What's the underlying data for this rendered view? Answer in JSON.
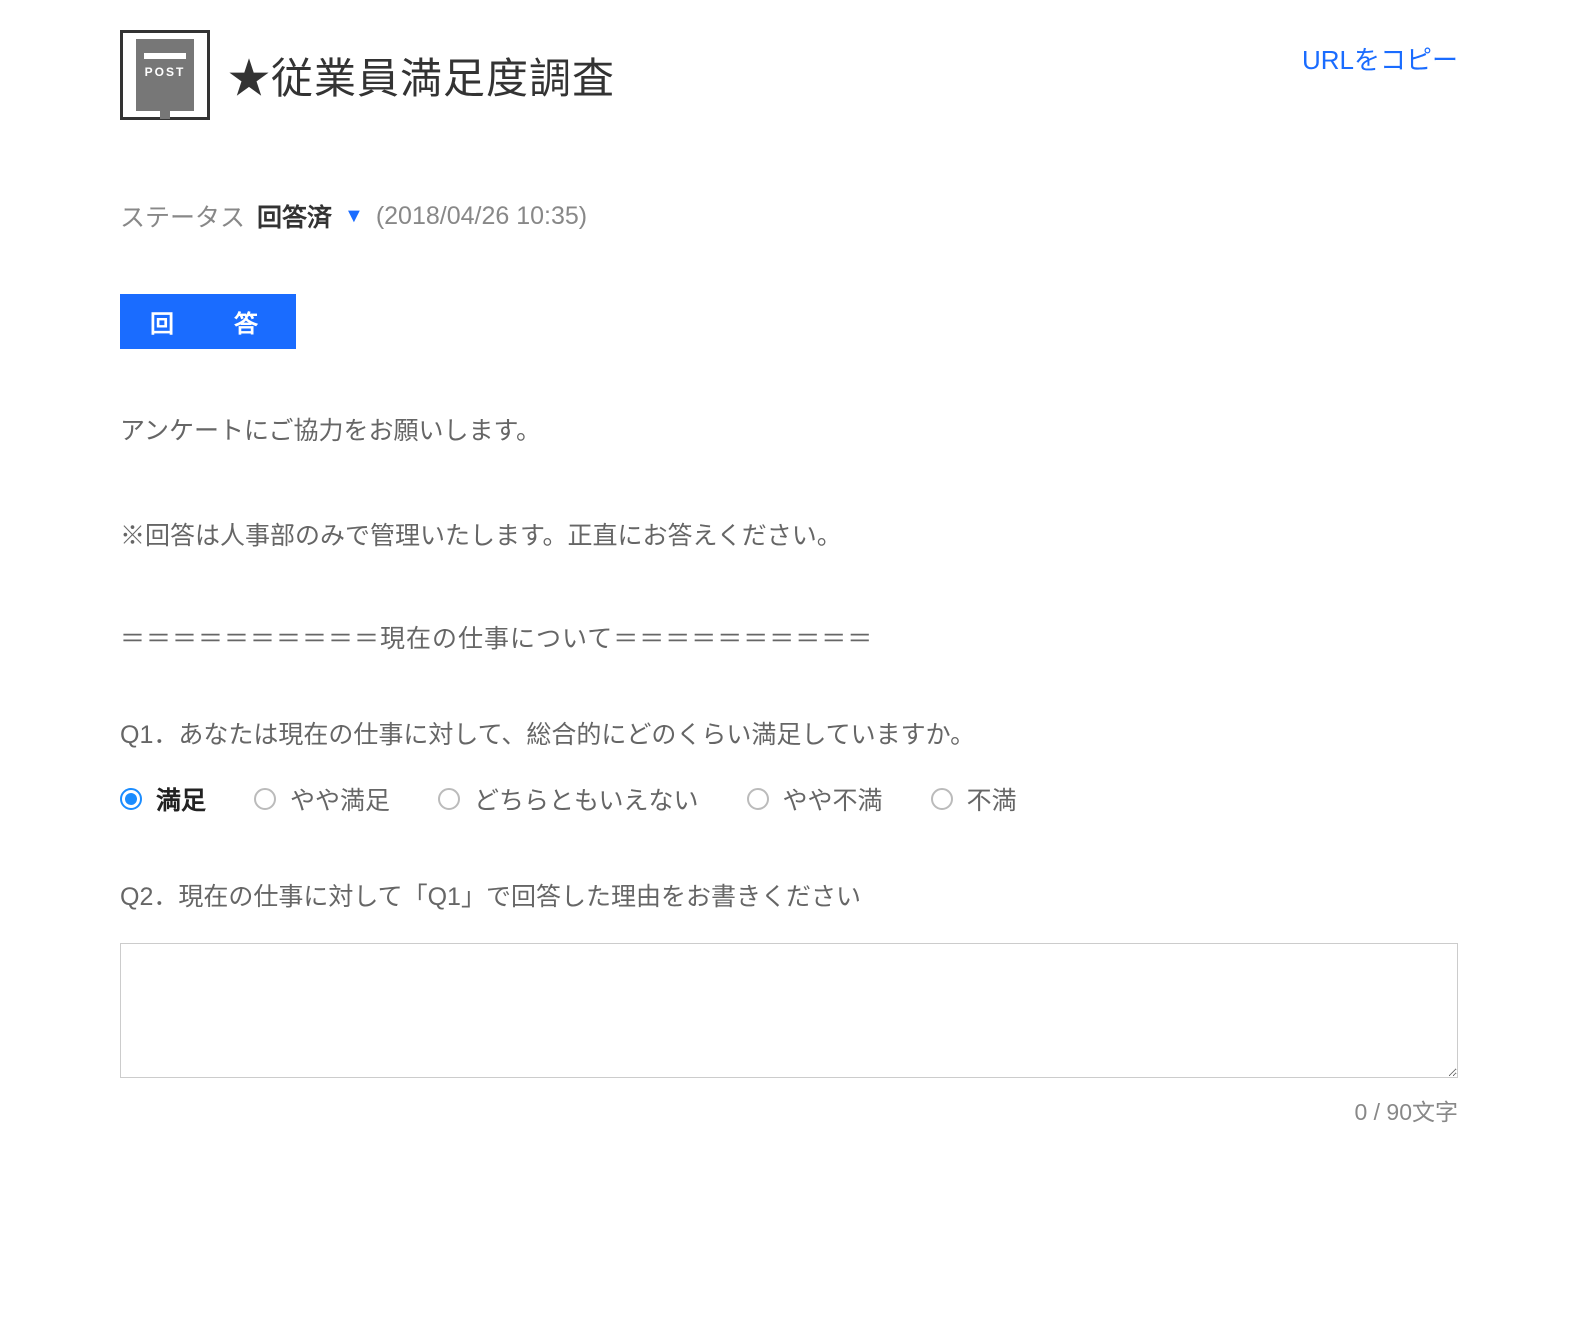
{
  "header": {
    "copy_url_label": "URLをコピー",
    "icon_label": "POST",
    "title": "★従業員満足度調査"
  },
  "status": {
    "label": "ステータス",
    "value": "回答済",
    "date": "(2018/04/26 10:35)"
  },
  "tab": {
    "answer": "回　答"
  },
  "body": {
    "intro1": "アンケートにご協力をお願いします。",
    "intro2": "※回答は人事部のみで管理いたします。正直にお答えください。",
    "divider": "＝＝＝＝＝＝＝＝＝＝現在の仕事について＝＝＝＝＝＝＝＝＝＝"
  },
  "q1": {
    "text": "Q1．あなたは現在の仕事に対して、総合的にどのくらい満足していますか。",
    "options": [
      "満足",
      "やや満足",
      "どちらともいえない",
      "やや不満",
      "不満"
    ],
    "selected_index": 0
  },
  "q2": {
    "text": "Q2．現在の仕事に対して「Q1」で回答した理由をお書きください",
    "value": "",
    "char_count": "0 / 90文字"
  }
}
